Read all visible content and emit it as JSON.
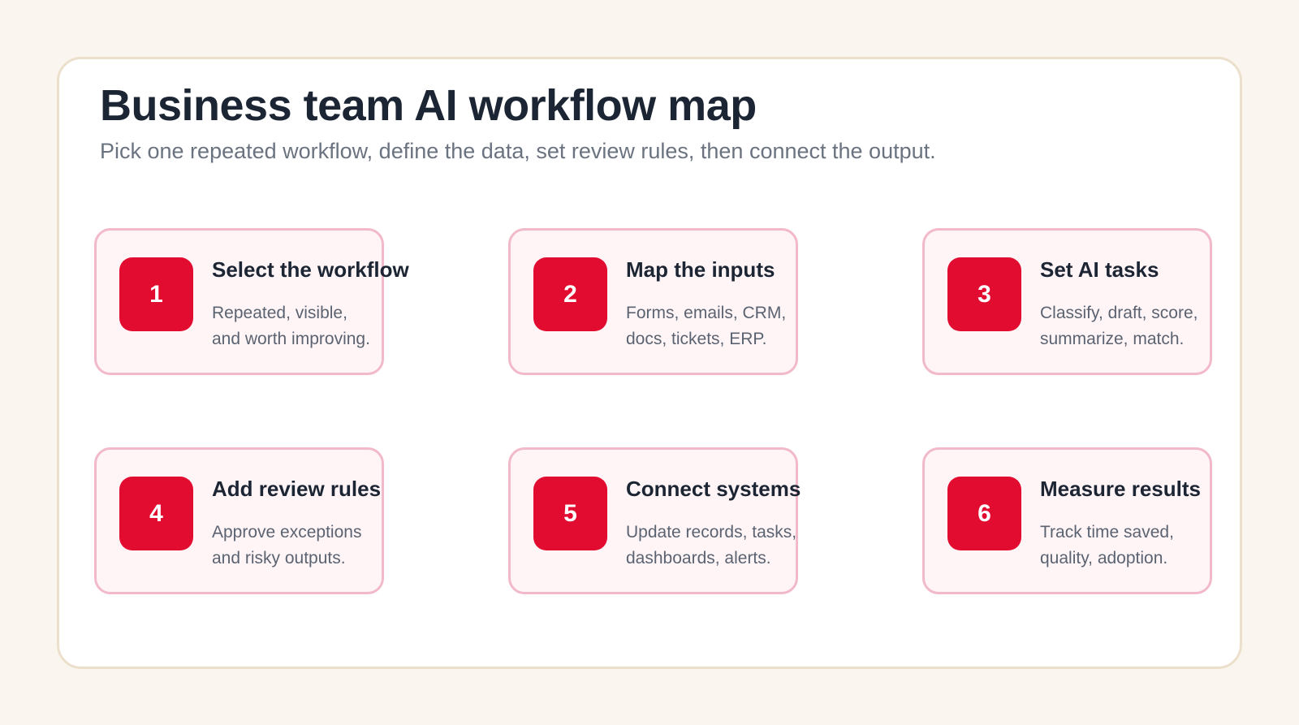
{
  "header": {
    "title": "Business team AI workflow map",
    "subtitle": "Pick one repeated workflow, define the data, set review rules, then connect the output."
  },
  "steps": [
    {
      "number": "1",
      "title": "Select the workflow",
      "desc_line1": "Repeated, visible,",
      "desc_line2": "and worth improving."
    },
    {
      "number": "2",
      "title": "Map the inputs",
      "desc_line1": "Forms, emails, CRM,",
      "desc_line2": "docs, tickets, ERP."
    },
    {
      "number": "3",
      "title": "Set AI tasks",
      "desc_line1": "Classify, draft, score,",
      "desc_line2": "summarize, match."
    },
    {
      "number": "4",
      "title": "Add review rules",
      "desc_line1": "Approve exceptions",
      "desc_line2": "and risky outputs."
    },
    {
      "number": "5",
      "title": "Connect systems",
      "desc_line1": "Update records, tasks,",
      "desc_line2": "dashboards, alerts."
    },
    {
      "number": "6",
      "title": "Measure results",
      "desc_line1": "Track time saved,",
      "desc_line2": "quality, adoption."
    }
  ],
  "colors": {
    "accent": "#e20c31",
    "card_background": "#fff5f7",
    "card_border": "#f1b9c9",
    "page_background": "#faf5ee"
  }
}
